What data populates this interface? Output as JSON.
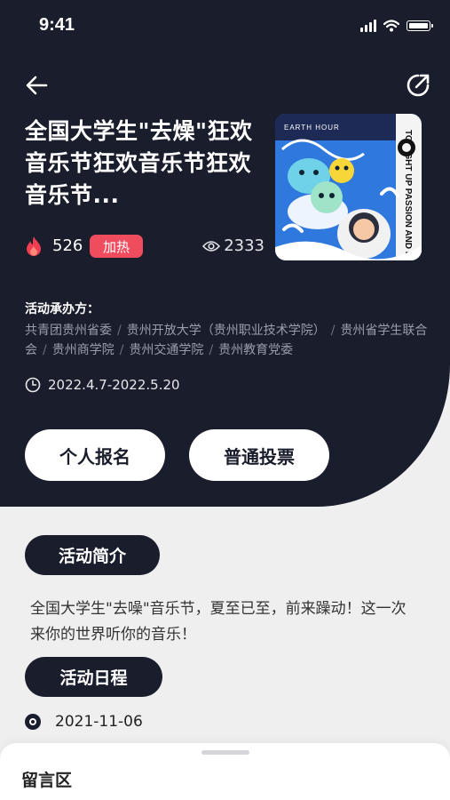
{
  "status_bar": {
    "time": "9:41"
  },
  "event": {
    "title": "全国大学生\"去燥\"狂欢音乐节狂欢音乐节狂欢音乐节...",
    "hot_count": "526",
    "boost_label": "加热",
    "views": "2333",
    "poster": {
      "text_top": "EARTH HOUR",
      "text_side": "TO LIGHT UP PASSION AND BRING JOY"
    }
  },
  "organizers": {
    "label": "活动承办方：",
    "items": [
      "共青团贵州省委",
      "贵州开放大学（贵州职业技术学院）",
      "贵州省学生联合会",
      "贵州商学院",
      "贵州交通学院",
      "贵州教育党委"
    ]
  },
  "date_range": "2022.4.7-2022.5.20",
  "actions": {
    "signup": "个人报名",
    "vote": "普通投票"
  },
  "intro": {
    "heading": "活动简介",
    "text": "全国大学生\"去噪\"音乐节，夏至已至，前来躁动！这一次来你的世界听你的音乐！"
  },
  "schedule": {
    "heading": "活动日程",
    "items": [
      {
        "date": "2021-11-06"
      }
    ]
  },
  "comments": {
    "title": "留言区"
  },
  "colors": {
    "dark": "#1a1e2c",
    "accent": "#ef4c5d",
    "bg": "#efeff0"
  }
}
